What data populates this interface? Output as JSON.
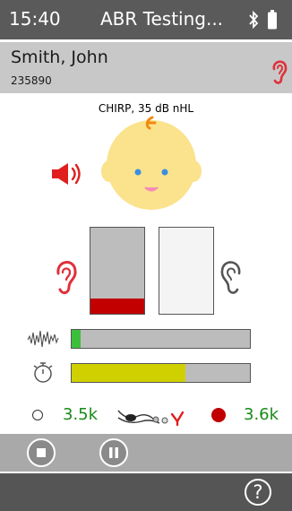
{
  "status_bar": {
    "time": "15:40",
    "title": "ABR Testing...",
    "icons": [
      "bluetooth-icon",
      "battery-icon"
    ]
  },
  "patient": {
    "name": "Smith, John",
    "id": "235890",
    "ear_icon": "ear-icon",
    "ear_color": "#e0303a"
  },
  "stimulus": {
    "label": "CHIRP,  35 dB nHL",
    "speaker_icon": "speaker-icon",
    "speaker_color": "#e01e1e"
  },
  "channels": {
    "left": {
      "level_fraction": 0.18,
      "fill_color": "#c20000",
      "ear_color": "#e0303a"
    },
    "right": {
      "level_fraction": 0.0,
      "ear_color": "#555555"
    }
  },
  "noise_bar": {
    "icon": "noise-waveform-icon",
    "fill_fraction": 0.05,
    "fill_color": "#3cc03c"
  },
  "time_bar": {
    "icon": "stopwatch-icon",
    "fill_fraction": 0.64,
    "fill_color": "#d0d000"
  },
  "counts": {
    "left_value": "3.5k",
    "right_value": "3.6k",
    "left_indicator": "empty",
    "right_indicator": "filled",
    "electrode_icon": "electrode-cable-icon"
  },
  "controls": {
    "stop_icon": "stop-icon",
    "pause_icon": "pause-icon"
  },
  "footer": {
    "help_label": "?"
  }
}
